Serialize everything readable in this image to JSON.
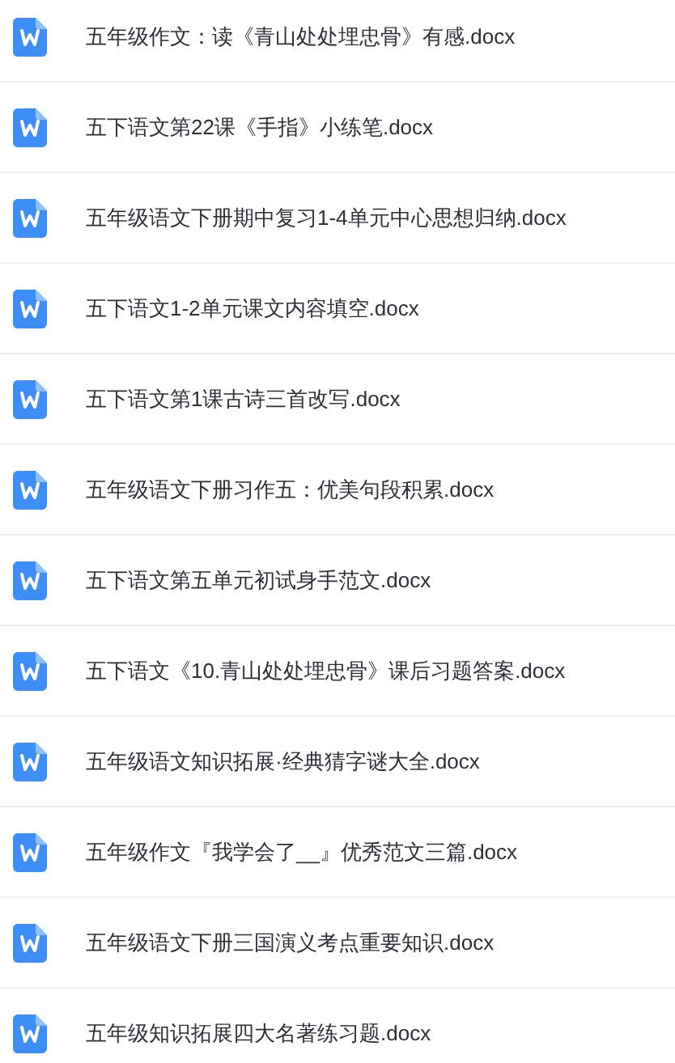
{
  "files": [
    {
      "name": "五年级作文：读《青山处处埋忠骨》有感.docx"
    },
    {
      "name": "五下语文第22课《手指》小练笔.docx"
    },
    {
      "name": "五年级语文下册期中复习1-4单元中心思想归纳.docx"
    },
    {
      "name": "五下语文1-2单元课文内容填空.docx"
    },
    {
      "name": "五下语文第1课古诗三首改写.docx"
    },
    {
      "name": "五年级语文下册习作五：优美句段积累.docx"
    },
    {
      "name": "五下语文第五单元初试身手范文.docx"
    },
    {
      "name": "五下语文《10.青山处处埋忠骨》课后习题答案.docx"
    },
    {
      "name": "五年级语文知识拓展·经典猜字谜大全.docx"
    },
    {
      "name": "五年级作文『我学会了__』优秀范文三篇.docx"
    },
    {
      "name": "五年级语文下册三国演义考点重要知识.docx"
    },
    {
      "name": "五年级知识拓展四大名著练习题.docx"
    }
  ]
}
